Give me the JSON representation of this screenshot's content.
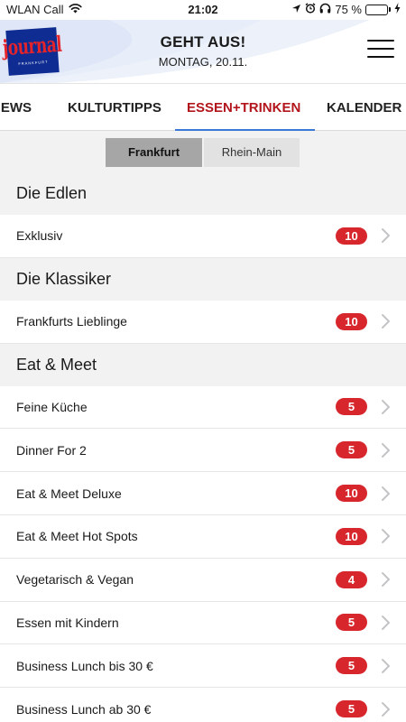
{
  "status_bar": {
    "carrier": "WLAN Call",
    "time": "21:02",
    "battery_percent": "75 %",
    "battery_level": 0.75,
    "icons": [
      "wifi-icon",
      "location-icon",
      "alarm-icon",
      "headphones-icon",
      "battery-icon",
      "charging-icon"
    ]
  },
  "header": {
    "logo_text": "journal",
    "logo_subtext": "FRANKFURT",
    "title": "GEHT AUS!",
    "date": "MONTAG, 20.11.",
    "menu_icon": "hamburger-menu-icon",
    "logo_colors": {
      "background": "#0f2c92",
      "text": "#e4232a"
    }
  },
  "tabs": [
    {
      "label": "NEWS",
      "active": false
    },
    {
      "label": "KULTURTIPPS",
      "active": false
    },
    {
      "label": "ESSEN+TRINKEN",
      "active": true
    },
    {
      "label": "KALENDER",
      "active": false
    }
  ],
  "segments": [
    {
      "label": "Frankfurt",
      "selected": true
    },
    {
      "label": "Rhein-Main",
      "selected": false
    }
  ],
  "sections": [
    {
      "title": "Die Edlen",
      "items": [
        {
          "label": "Exklusiv",
          "count": "10"
        }
      ]
    },
    {
      "title": "Die Klassiker",
      "items": [
        {
          "label": "Frankfurts Lieblinge",
          "count": "10"
        }
      ]
    },
    {
      "title": "Eat & Meet",
      "items": [
        {
          "label": "Feine Küche",
          "count": "5"
        },
        {
          "label": "Dinner For 2",
          "count": "5"
        },
        {
          "label": "Eat & Meet Deluxe",
          "count": "10"
        },
        {
          "label": "Eat & Meet Hot Spots",
          "count": "10"
        },
        {
          "label": "Vegetarisch & Vegan",
          "count": "4"
        },
        {
          "label": "Essen mit Kindern",
          "count": "5"
        },
        {
          "label": "Business Lunch bis 30 €",
          "count": "5"
        },
        {
          "label": "Business Lunch ab 30 €",
          "count": "5"
        }
      ]
    }
  ],
  "colors": {
    "accent_tab": "#b3151c",
    "tab_underline": "#3b79d6",
    "badge": "#d7262c",
    "section_background": "#f2f2f2"
  }
}
